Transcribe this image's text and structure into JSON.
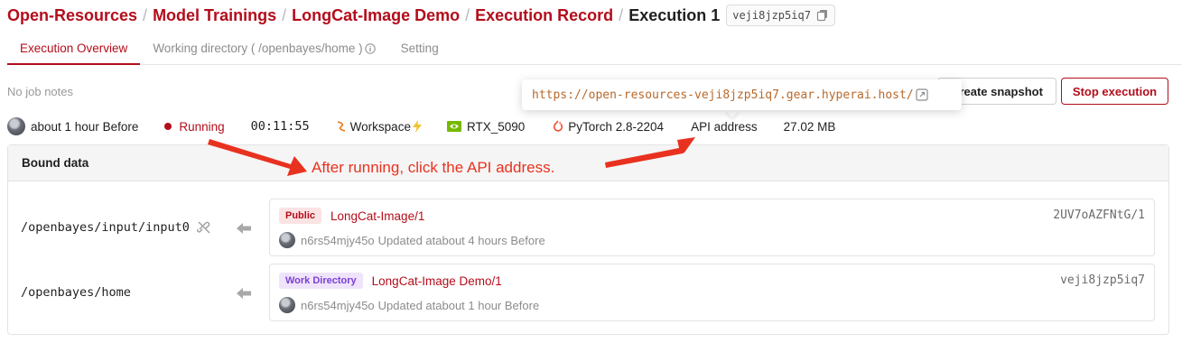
{
  "breadcrumb": {
    "items": [
      "Open-Resources",
      "Model Trainings",
      "LongCat-Image Demo",
      "Execution Record"
    ],
    "current": "Execution 1",
    "id": "veji8jzp5iq7"
  },
  "tabs": [
    {
      "label": "Execution Overview",
      "active": true
    },
    {
      "label": "Working directory ( /openbayes/home )",
      "active": false
    },
    {
      "label": "Setting",
      "active": false
    }
  ],
  "job_notes": "No job notes",
  "tooltip": {
    "url": "https://open-resources-veji8jzp5iq7.gear.hyperai.host/"
  },
  "actions": {
    "snapshot_label": "Create snapshot",
    "stop_label": "Stop execution"
  },
  "status": {
    "time_ago": "about 1 hour Before",
    "state": "Running",
    "duration": "00:11:55",
    "workspace": "Workspace",
    "gpu": "RTX_5090",
    "framework": "PyTorch 2.8-2204",
    "api_address": "API address",
    "size": "27.02 MB"
  },
  "annotation": "After running, click the API address.",
  "bound_data": {
    "title": "Bound data",
    "rows": [
      {
        "path": "/openbayes/input/input0",
        "badge": "Public",
        "dataset": "LongCat-Image/1",
        "id": "2UV7oAZFNtG/1",
        "user": "n6rs54mjy45o",
        "updated": "Updated atabout 4 hours Before"
      },
      {
        "path": "/openbayes/home",
        "badge": "Work Directory",
        "dataset": "LongCat-Image Demo/1",
        "id": "veji8jzp5iq7",
        "user": "n6rs54mjy45o",
        "updated": "Updated atabout 1 hour Before"
      }
    ]
  },
  "colors": {
    "brand": "#b30d1b",
    "annotation": "#e8321f",
    "work_badge": "#7b3fd6"
  },
  "icons": [
    "copy-icon",
    "info-icon",
    "open-external-icon",
    "workspace-icon",
    "lightning-icon",
    "nvidia-icon",
    "pytorch-icon",
    "unlink-icon",
    "arrow-left-icon"
  ]
}
